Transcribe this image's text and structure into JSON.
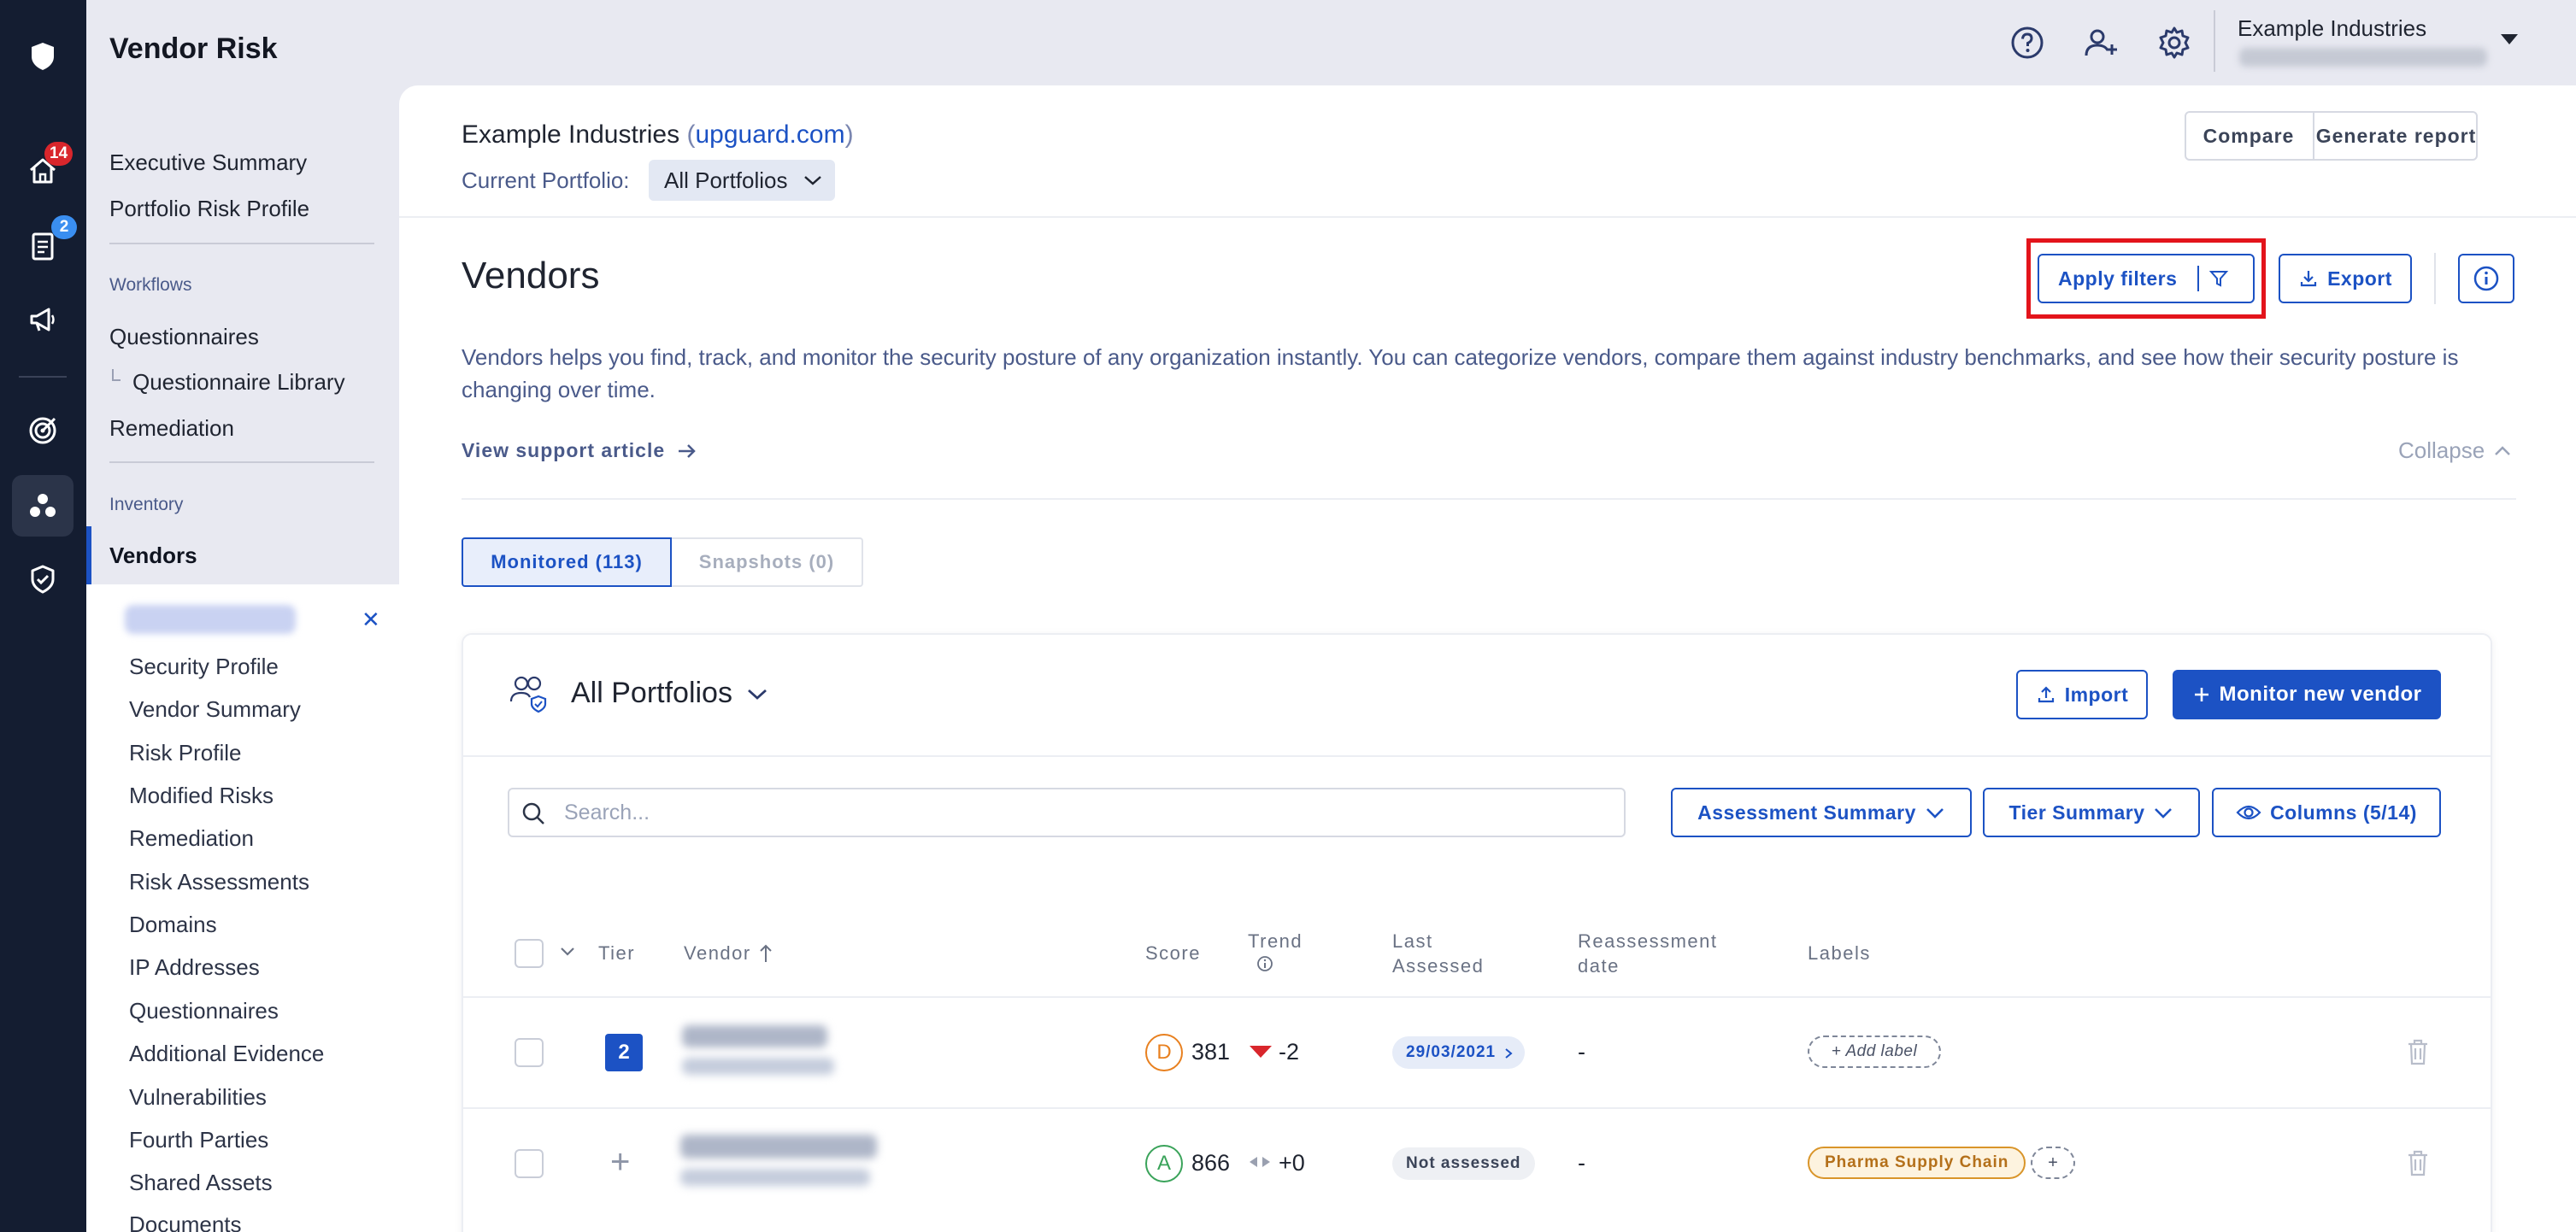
{
  "rail": {
    "home_badge": "14",
    "docs_badge": "2",
    "badge_red": "#d9262c",
    "badge_blue": "#3a8ef0"
  },
  "nav": {
    "app_title": "Vendor Risk",
    "items_top": [
      "Executive Summary",
      "Portfolio Risk Profile"
    ],
    "section_workflows": "Workflows",
    "questionnaires": "Questionnaires",
    "questionnaire_library": "Questionnaire Library",
    "remediation": "Remediation",
    "section_inventory": "Inventory",
    "vendors": "Vendors",
    "vendor_sub_items": [
      "Security Profile",
      "Vendor Summary",
      "Risk Profile",
      "Modified Risks",
      "Remediation",
      "Risk Assessments",
      "Domains",
      "IP Addresses",
      "Questionnaires",
      "Additional Evidence",
      "Vulnerabilities",
      "Fourth Parties",
      "Shared Assets",
      "Documents"
    ]
  },
  "topbar": {
    "org_name": "Example Industries",
    "icons": [
      "help-icon",
      "add-user-icon",
      "settings-icon"
    ]
  },
  "header": {
    "company": "Example Industries",
    "domain": "upguard.com",
    "paren_open": " (",
    "paren_close": ")",
    "portfolio_label": "Current Portfolio:",
    "portfolio_value": "All Portfolios",
    "compare": "Compare",
    "generate_report": "Generate report"
  },
  "vendors": {
    "title": "Vendors",
    "apply_filters": "Apply filters",
    "export": "Export",
    "description": "Vendors helps you find, track, and monitor the security posture of any organization instantly. You can categorize vendors, compare them against industry benchmarks, and see how their security posture is changing over time.",
    "support_link": "View support article",
    "collapse": "Collapse",
    "tab_monitored": "Monitored (113)",
    "tab_snapshots": "Snapshots (0)"
  },
  "card": {
    "portfolio": "All Portfolios",
    "import": "Import",
    "monitor_new": "Monitor new vendor",
    "search_placeholder": "Search...",
    "assessment_summary": "Assessment Summary",
    "tier_summary": "Tier Summary",
    "columns": "Columns (5/14)"
  },
  "table": {
    "headers": {
      "tier": "Tier",
      "vendor": "Vendor",
      "score": "Score",
      "trend": "Trend",
      "last": "Last",
      "assessed": "Assessed",
      "reassessment": "Reassessment",
      "date": "date",
      "labels": "Labels"
    },
    "rows": [
      {
        "tier": "2",
        "grade": "D",
        "grade_color": "#e8801f",
        "score": "381",
        "trend": "-2",
        "last_assessed": "29/03/2021",
        "reassessment": "-",
        "label": "+ Add label"
      },
      {
        "tier": "+",
        "grade": "A",
        "grade_color": "#3aa35a",
        "score": "866",
        "trend": "+0",
        "last_assessed": "Not assessed",
        "reassessment": "-",
        "label": "Pharma Supply Chain",
        "label_extra": "+"
      }
    ]
  },
  "colors": {
    "accent": "#1c52c4",
    "highlight_box": "#e3141b"
  }
}
